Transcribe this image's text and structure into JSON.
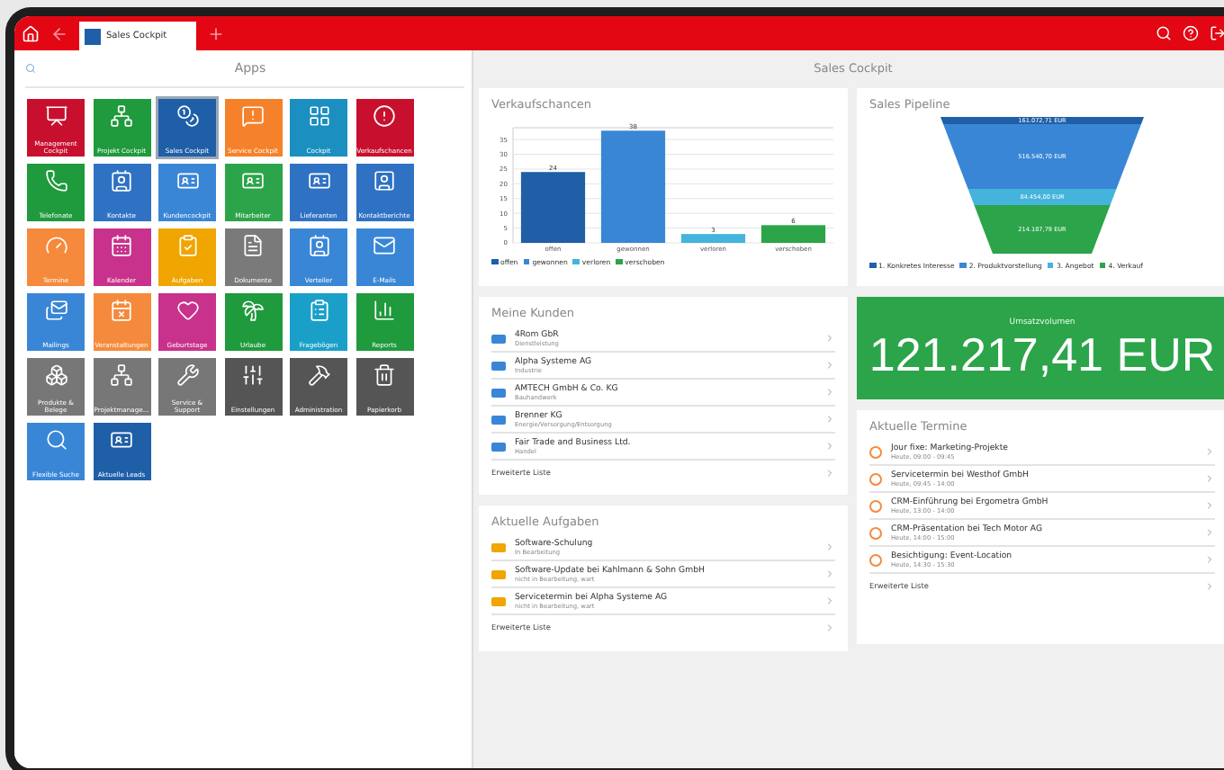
{
  "topbar": {
    "tabs": [
      {
        "label": "Sales Cockpit",
        "selected": true
      }
    ]
  },
  "apps": {
    "title": "Apps",
    "tiles": [
      {
        "label": "Management Cockpit",
        "color": "#c8102e",
        "selected": false
      },
      {
        "label": "Projekt Cockpit",
        "color": "#1f9a3c",
        "selected": false
      },
      {
        "label": "Sales Cockpit",
        "color": "#1f5fa8",
        "selected": true
      },
      {
        "label": "Service Cockpit",
        "color": "#f5822a",
        "selected": false
      },
      {
        "label": "Cockpit",
        "color": "#1a8fc0",
        "selected": false
      },
      {
        "label": "Verkaufschancen",
        "color": "#c8102e",
        "selected": false
      },
      {
        "label": "Telefonate",
        "color": "#1f9a3c",
        "selected": false
      },
      {
        "label": "Kontakte",
        "color": "#2f72c4",
        "selected": false
      },
      {
        "label": "Kundencockpit",
        "color": "#3a86d6",
        "selected": false
      },
      {
        "label": "Mitarbeiter",
        "color": "#2ca44a",
        "selected": false
      },
      {
        "label": "Lieferanten",
        "color": "#2f72c4",
        "selected": false
      },
      {
        "label": "Kontaktberichte",
        "color": "#2f72c4",
        "selected": false
      },
      {
        "label": "Termine",
        "color": "#f58a3c",
        "selected": false
      },
      {
        "label": "Kalender",
        "color": "#c8328c",
        "selected": false
      },
      {
        "label": "Aufgaben",
        "color": "#f0a500",
        "selected": false
      },
      {
        "label": "Dokumente",
        "color": "#7a7a7a",
        "selected": false
      },
      {
        "label": "Verteiler",
        "color": "#3a86d6",
        "selected": false
      },
      {
        "label": "E-Mails",
        "color": "#3a86d6",
        "selected": false
      },
      {
        "label": "Mailings",
        "color": "#3a86d6",
        "selected": false
      },
      {
        "label": "Veranstaltungen",
        "color": "#f58a3c",
        "selected": false
      },
      {
        "label": "Geburtstage",
        "color": "#c8328c",
        "selected": false
      },
      {
        "label": "Urlaube",
        "color": "#1f9a3c",
        "selected": false
      },
      {
        "label": "Fragebögen",
        "color": "#1aa0c8",
        "selected": false
      },
      {
        "label": "Reports",
        "color": "#1f9a3c",
        "selected": false
      },
      {
        "label": "Produkte & Belege",
        "color": "#777777",
        "selected": false
      },
      {
        "label": "Projektmanage...",
        "color": "#777777",
        "selected": false
      },
      {
        "label": "Service & Support",
        "color": "#777777",
        "selected": false
      },
      {
        "label": "Einstellungen",
        "color": "#555555",
        "selected": false
      },
      {
        "label": "Administration",
        "color": "#555555",
        "selected": false
      },
      {
        "label": "Papierkorb",
        "color": "#555555",
        "selected": false
      },
      {
        "label": "Flexible Suche",
        "color": "#3a86d6",
        "selected": false
      },
      {
        "label": "Aktuelle Leads",
        "color": "#1f5fa8",
        "selected": false
      }
    ]
  },
  "cockpit": {
    "title": "Sales Cockpit",
    "verkaufschancen": {
      "title": "Verkaufschancen",
      "chart_data": {
        "type": "bar",
        "categories": [
          "offen",
          "gewonnen",
          "verloren",
          "verschoben"
        ],
        "stacked": true,
        "data_labels": true,
        "grid": true,
        "ylim": [
          0,
          39
        ],
        "yticks": [
          0,
          5,
          10,
          15,
          20,
          25,
          30,
          35
        ],
        "series": [
          {
            "name": "offen",
            "color": "#1f5fa8",
            "values": [
              24,
              null,
              null,
              null
            ]
          },
          {
            "name": "gewonnen",
            "color": "#3a86d6",
            "values": [
              null,
              38,
              null,
              null
            ]
          },
          {
            "name": "verloren",
            "color": "#45b4dc",
            "values": [
              null,
              null,
              3,
              null
            ]
          },
          {
            "name": "verschoben",
            "color": "#2ca44a",
            "values": [
              null,
              null,
              null,
              6
            ]
          }
        ]
      }
    },
    "pipeline": {
      "title": "Sales Pipeline",
      "stages": [
        {
          "name": "1. Konkretes Interesse",
          "value": "161.072,71 EUR",
          "color": "#1f5fa8"
        },
        {
          "name": "2. Produktvorstellung",
          "value": "516.540,70 EUR",
          "color": "#3a86d6"
        },
        {
          "name": "3. Angebot",
          "value": "84.454,00 EUR",
          "color": "#45b4dc"
        },
        {
          "name": "4. Verkauf",
          "value": "214.187,79 EUR",
          "color": "#2ca44a"
        }
      ]
    },
    "umsatz": {
      "label": "Umsatzvolumen",
      "value": "121.217,41 EUR"
    },
    "kunden": {
      "title": "Meine Kunden",
      "items": [
        {
          "title": "4Rom GbR",
          "subtitle": "Dienstleistung"
        },
        {
          "title": "Alpha Systeme AG",
          "subtitle": "Industrie"
        },
        {
          "title": "AMTECH GmbH & Co. KG",
          "subtitle": "Bauhandwerk"
        },
        {
          "title": "Brenner KG",
          "subtitle": "Energie/Versorgung/Entsorgung"
        },
        {
          "title": "Fair Trade and Business Ltd.",
          "subtitle": "Handel"
        }
      ],
      "more": "Erweiterte Liste"
    },
    "aufgaben": {
      "title": "Aktuelle Aufgaben",
      "items": [
        {
          "title": "Software-Schulung",
          "subtitle": "In Bearbeitung"
        },
        {
          "title": "Software-Update bei Kahlmann & Sohn GmbH",
          "subtitle": "nicht in Bearbeitung, wart"
        },
        {
          "title": "Servicetermin bei Alpha Systeme AG",
          "subtitle": "nicht in Bearbeitung, wart"
        }
      ],
      "more": "Erweiterte Liste"
    },
    "termine": {
      "title": "Aktuelle Termine",
      "items": [
        {
          "title": "Jour fixe: Marketing-Projekte",
          "subtitle": "Heute, 09:00 - 09:45"
        },
        {
          "title": "Servicetermin bei Westhof GmbH",
          "subtitle": "Heute, 09:45 - 14:00"
        },
        {
          "title": "CRM-Einführung bei Ergometra GmbH",
          "subtitle": "Heute, 13:00 - 14:00"
        },
        {
          "title": "CRM-Präsentation bei Tech Motor AG",
          "subtitle": "Heute, 14:00 - 15:00"
        },
        {
          "title": "Besichtigung: Event-Location",
          "subtitle": "Heute, 14:30 - 15:30"
        }
      ],
      "more": "Erweiterte Liste"
    }
  }
}
